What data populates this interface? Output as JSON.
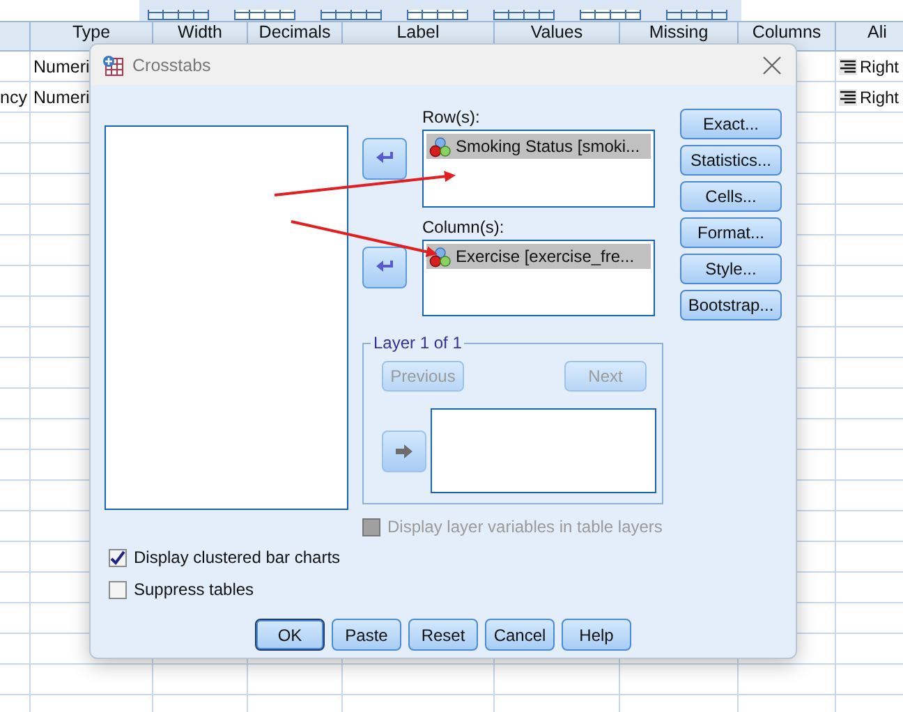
{
  "sheet": {
    "columns": [
      "Type",
      "Width",
      "Decimals",
      "Label",
      "Values",
      "Missing",
      "Columns",
      "Ali"
    ],
    "rows": [
      {
        "type": "Numeri",
        "align": "Right"
      },
      {
        "name": "ncy",
        "type": "Numeri",
        "align": "Right"
      }
    ]
  },
  "dialog": {
    "title": "Crosstabs",
    "row_list": {
      "label": "Row(s):",
      "items": [
        {
          "text": "Smoking Status [smoki...",
          "selected": true
        }
      ]
    },
    "column_list": {
      "label": "Column(s):",
      "items": [
        {
          "text": "Exercise  [exercise_fre...",
          "selected": true
        }
      ]
    },
    "side_buttons": [
      "Exact...",
      "Statistics...",
      "Cells...",
      "Format...",
      "Style...",
      "Bootstrap..."
    ],
    "layer": {
      "title": "Layer 1 of 1",
      "previous": {
        "label": "Previous",
        "disabled": true
      },
      "next": {
        "label": "Next",
        "disabled": true
      }
    },
    "layer_option": {
      "label": "Display layer variables in table layers",
      "checked": false,
      "disabled": true
    },
    "options": [
      {
        "label": "Display clustered bar charts",
        "checked": true
      },
      {
        "label": "Suppress tables",
        "checked": false
      }
    ],
    "buttons": [
      {
        "label": "OK",
        "default": true
      },
      {
        "label": "Paste",
        "default": false
      },
      {
        "label": "Reset",
        "default": false
      },
      {
        "label": "Cancel",
        "default": false
      },
      {
        "label": "Help",
        "default": false
      }
    ]
  }
}
